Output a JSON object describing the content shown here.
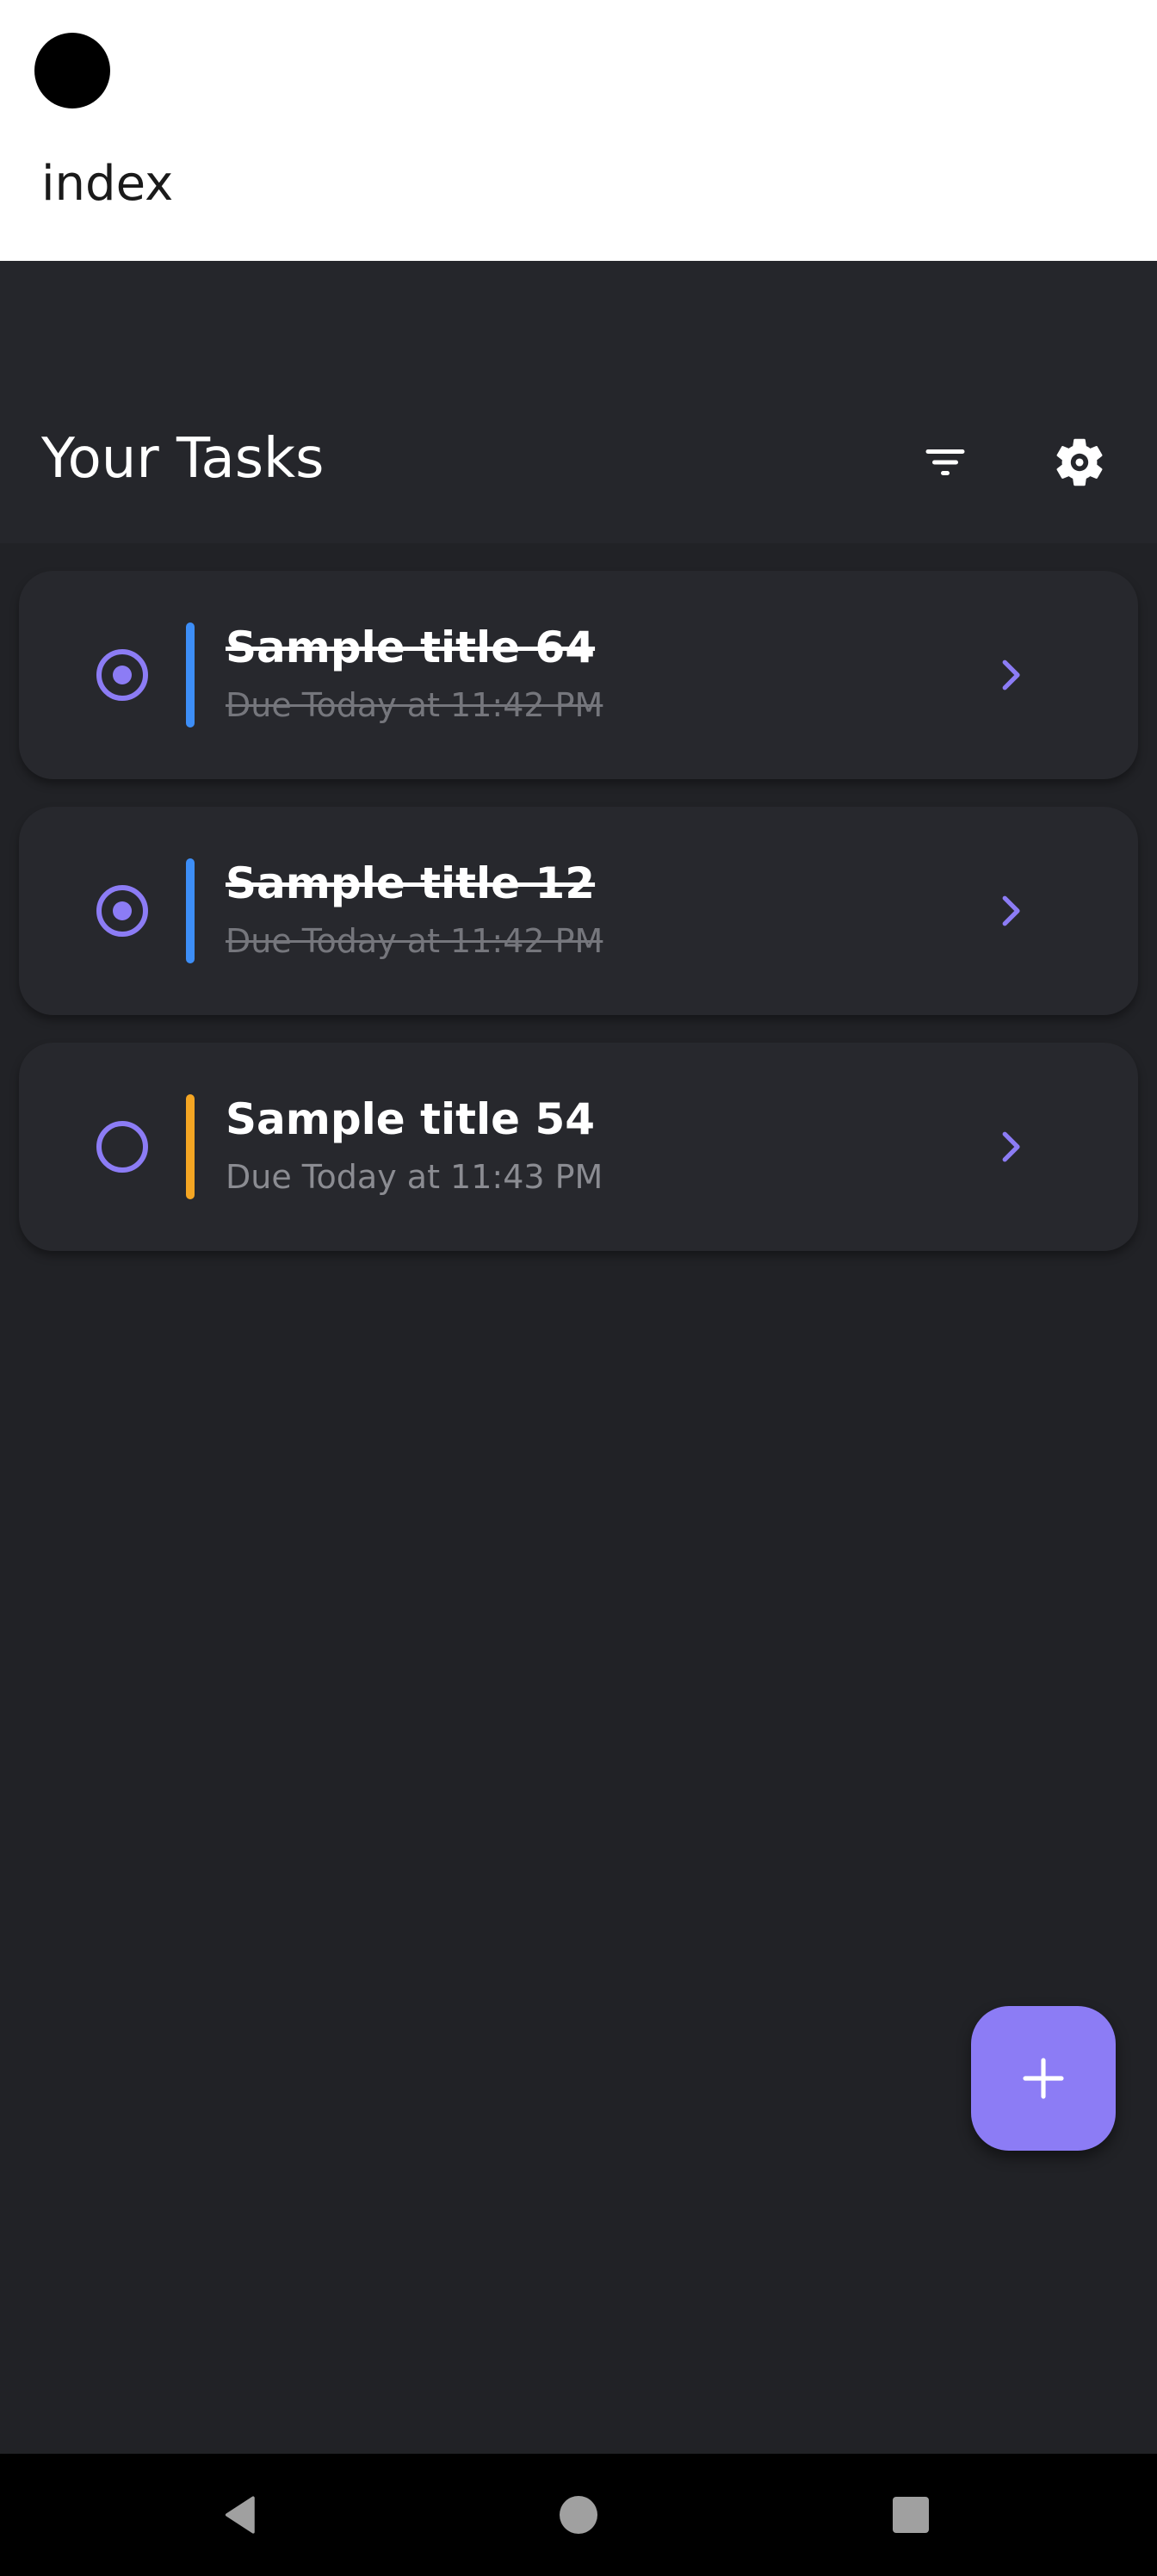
{
  "header": {
    "route_title": "index"
  },
  "app_bar": {
    "title": "Your Tasks",
    "icons": [
      "filter-icon",
      "gear-icon"
    ]
  },
  "tasks": [
    {
      "title": "Sample title 64",
      "due": "Due Today at 11:42 PM",
      "completed": true,
      "priority_color": "#3d8ef7"
    },
    {
      "title": "Sample title 12",
      "due": "Due Today at 11:42 PM",
      "completed": true,
      "priority_color": "#3d8ef7"
    },
    {
      "title": "Sample title 54",
      "due": "Due Today at 11:43 PM",
      "completed": false,
      "priority_color": "#f5a623"
    }
  ],
  "fab": {
    "icon": "plus-icon"
  },
  "nav_bar": {
    "icons": [
      "back-icon",
      "home-icon",
      "recents-icon"
    ]
  },
  "colors": {
    "accent": "#8c7cf5",
    "background": "#212226",
    "card": "#27282d",
    "app_bar": "#25262b"
  }
}
